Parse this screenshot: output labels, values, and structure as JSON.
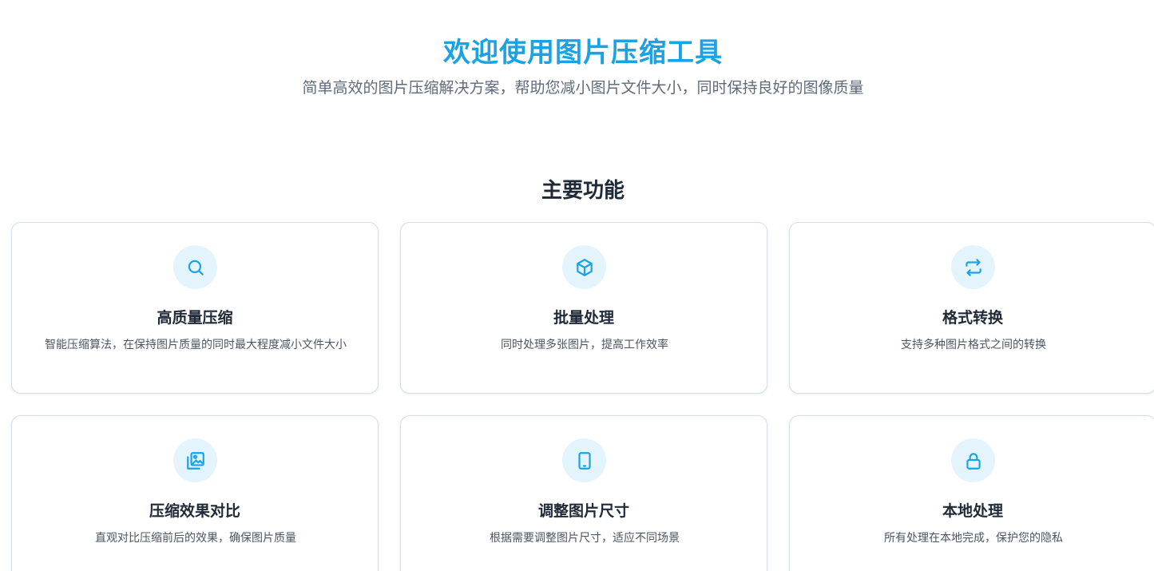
{
  "hero": {
    "title": "欢迎使用图片压缩工具",
    "subtitle": "简单高效的图片压缩解决方案，帮助您减小图片文件大小，同时保持良好的图像质量"
  },
  "features": {
    "section_title": "主要功能",
    "items": [
      {
        "icon": "search-icon",
        "title": "高质量压缩",
        "description": "智能压缩算法，在保持图片质量的同时最大程度减小文件大小"
      },
      {
        "icon": "box-icon",
        "title": "批量处理",
        "description": "同时处理多张图片，提高工作效率"
      },
      {
        "icon": "swap-icon",
        "title": "格式转换",
        "description": "支持多种图片格式之间的转换"
      },
      {
        "icon": "image-compare-icon",
        "title": "压缩效果对比",
        "description": "直观对比压缩前后的效果，确保图片质量"
      },
      {
        "icon": "tablet-icon",
        "title": "调整图片尺寸",
        "description": "根据需要调整图片尺寸，适应不同场景"
      },
      {
        "icon": "lock-icon",
        "title": "本地处理",
        "description": "所有处理在本地完成，保护您的隐私"
      }
    ]
  },
  "colors": {
    "accent": "#1aa3e4",
    "icon_bg": "#e3f4fc",
    "heading": "#1f2937",
    "text": "#4b5563"
  }
}
